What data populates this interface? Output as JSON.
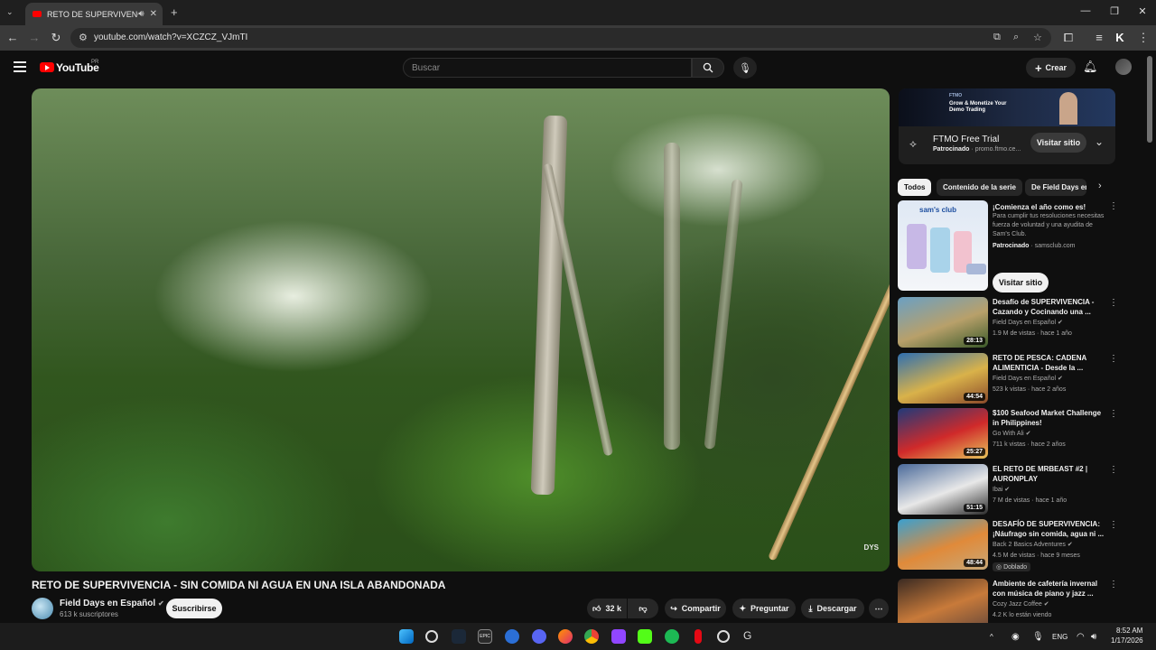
{
  "browser": {
    "tab_title": "RETO DE SUPERVIVENCIA",
    "url": "youtube.com/watch?v=XCZCZ_VJmTI"
  },
  "youtube": {
    "brand": "YouTube",
    "country": "PR",
    "search_placeholder": "Buscar",
    "create_label": "Crear"
  },
  "video": {
    "title": "RETO DE SUPERVIVENCIA - SIN COMIDA NI AGUA EN UNA ISLA ABANDONADA",
    "watermark": "DYS",
    "channel_name": "Field Days en Español",
    "subscribers": "613 k suscriptores",
    "subscribe_label": "Suscribirse",
    "likes": "32 k",
    "share_label": "Compartir",
    "ask_label": "Preguntar",
    "download_label": "Descargar"
  },
  "ad_top": {
    "brand": "FTMO",
    "banner_text": "Grow & Monetize Your Demo Trading",
    "title": "FTMO Free Trial",
    "sponsored": "Patrocinado",
    "domain": "promo.ftmo.ce...",
    "visit_label": "Visitar sitio"
  },
  "chips": [
    "Todos",
    "Contenido de la serie",
    "De Field Days en"
  ],
  "ad_side": {
    "thumb_brand": "sam's club",
    "title": "¡Comienza el año como es!",
    "description": "Para cumplir tus resoluciones necesitas fuerza de voluntad y una ayudita de Sam's Club.",
    "sponsored": "Patrocinado",
    "domain": "samsclub.com",
    "visit_label": "Visitar sitio"
  },
  "recommendations": [
    {
      "title": "Desafío de SUPERVIVENCIA - Cazando y Cocinando una ...",
      "channel": "Field Days en Español",
      "meta": "1.9 M de vistas · hace 1 año",
      "duration": "28:13",
      "colors": [
        "#6aa0c4",
        "#b8a06a",
        "#3b5a2a"
      ]
    },
    {
      "title": "RETO DE PESCA: CADENA ALIMENTICIA - Desde la ...",
      "channel": "Field Days en Español",
      "meta": "523 k vistas · hace 2 años",
      "duration": "44:54",
      "colors": [
        "#2f6fb0",
        "#d9b24a",
        "#8a4a2a"
      ]
    },
    {
      "title": "$100 Seafood Market Challenge in Philippines!",
      "channel": "Go With Ali",
      "meta": "711 k vistas · hace 2 años",
      "duration": "25:27",
      "colors": [
        "#1f3a7a",
        "#d02a2a",
        "#e6c35a"
      ]
    },
    {
      "title": "EL RETO DE MRBEAST #2 | AURONPLAY",
      "channel": "Ibai",
      "meta": "7 M de vistas · hace 1 año",
      "duration": "51:15",
      "colors": [
        "#4a6a9a",
        "#e8e8e8",
        "#2a2a2a"
      ]
    },
    {
      "title": "DESAFÍO DE SUPERVIVENCIA: ¡Náufrago sin comida, agua ni ...",
      "channel": "Back 2 Basics Adventures",
      "meta": "4.5 M de vistas · hace 9 meses",
      "duration": "48:44",
      "badge": "Doblado",
      "colors": [
        "#3aa0d0",
        "#e08a3a",
        "#c8a878"
      ]
    },
    {
      "title": "Ambiente de cafetería invernal con música de piano y jazz ...",
      "channel": "Cozy Jazz Coffee",
      "meta": "4.2 K lo están viendo",
      "colors": [
        "#3a2a22",
        "#c87a3a",
        "#6a4a3a"
      ]
    }
  ],
  "taskbar": {
    "language": "ENG",
    "time": "8:52 AM",
    "date": "1/17/2026",
    "epic_label": "EPIC"
  }
}
